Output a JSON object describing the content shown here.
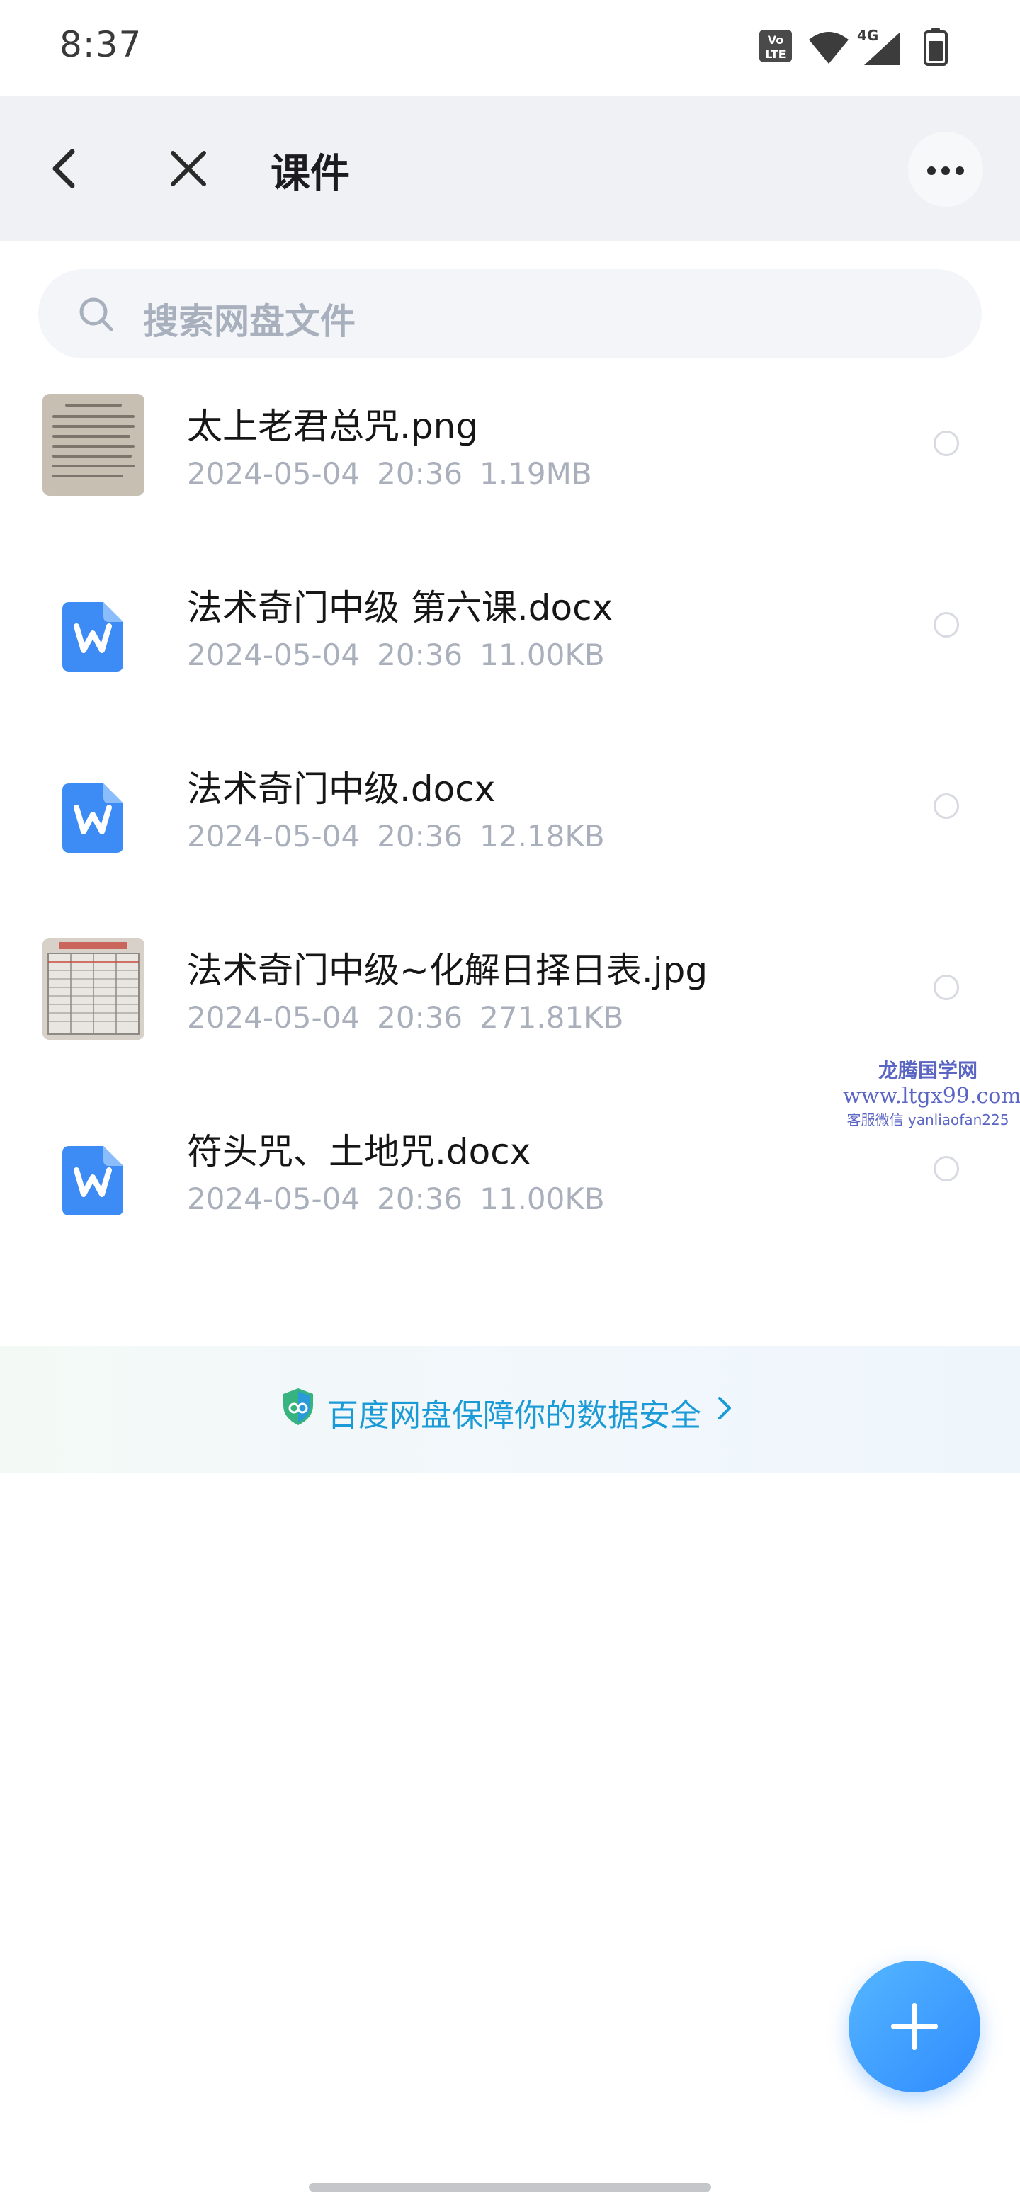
{
  "status_bar": {
    "time": "8:37",
    "network_label": "4G",
    "icons": [
      "volte-icon",
      "wifi-icon",
      "cellular-signal-icon",
      "battery-icon"
    ]
  },
  "nav": {
    "title": "课件",
    "icons": [
      "back-arrow-icon",
      "close-icon",
      "more-dots-icon"
    ]
  },
  "search": {
    "placeholder": "搜索网盘文件"
  },
  "files": [
    {
      "name": "太上老君总咒.png",
      "date": "2024-05-04",
      "time": "20:36",
      "size": "1.19MB",
      "type": "image"
    },
    {
      "name": "法术奇门中级 第六课.docx",
      "date": "2024-05-04",
      "time": "20:36",
      "size": "11.00KB",
      "type": "docx"
    },
    {
      "name": "法术奇门中级.docx",
      "date": "2024-05-04",
      "time": "20:36",
      "size": "12.18KB",
      "type": "docx"
    },
    {
      "name": "法术奇门中级~化解日择日表.jpg",
      "date": "2024-05-04",
      "time": "20:36",
      "size": "271.81KB",
      "type": "image"
    },
    {
      "name": "符头咒、土地咒.docx",
      "date": "2024-05-04",
      "time": "20:36",
      "size": "11.00KB",
      "type": "docx"
    }
  ],
  "watermark": {
    "line1": "龙腾国学网",
    "line2": "www.ltgx99.com",
    "line3": "客服微信 yanliaofan225"
  },
  "safety_banner": {
    "text": "百度网盘保障你的数据安全"
  },
  "colors": {
    "accent": "#2f8bff",
    "safety_text": "#1a9ad6",
    "meta_text": "#aab0bb",
    "doc_icon": "#3d8bf5"
  }
}
